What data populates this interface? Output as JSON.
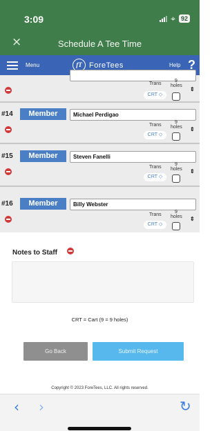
{
  "status_bar": {
    "time": "3:09",
    "battery": "92"
  },
  "title_bar": {
    "title": "Schedule A Tee Time",
    "close_glyph": "×"
  },
  "nav": {
    "menu_label": "Menu",
    "logo_text": "ForeTees",
    "logo_mark": "fT",
    "help_label": "Help",
    "help_glyph": "?"
  },
  "labels": {
    "trans": "Trans",
    "holes_num": "9",
    "holes_word": "holes",
    "crt": "CRT ◇",
    "sort": "⇕"
  },
  "players": [
    {
      "slot": "",
      "type": "",
      "name": ""
    },
    {
      "slot": "#14",
      "type": "Member",
      "name": "Michael Perdigao"
    },
    {
      "slot": "#15",
      "type": "Member",
      "name": "Steven Fanelli"
    },
    {
      "slot": "#16",
      "type": "Member",
      "name": "Billy Webster"
    }
  ],
  "notes": {
    "label": "Notes to Staff",
    "value": ""
  },
  "legend": "CRT = Cart  (9 = 9 holes)",
  "buttons": {
    "back": "Go Back",
    "submit": "Submit Request"
  },
  "copyright": "Copyright © 2023 ForeTees, LLC. All rights reserved.",
  "toolbar": {
    "back": "‹",
    "forward": "›",
    "reload": "↻"
  },
  "colors": {
    "title_bar": "#3f7d4a",
    "nav_bar": "#3a64b5",
    "member_button": "#4a7fc6",
    "submit_button": "#57b8ee",
    "remove_icon": "#d23a3a"
  }
}
